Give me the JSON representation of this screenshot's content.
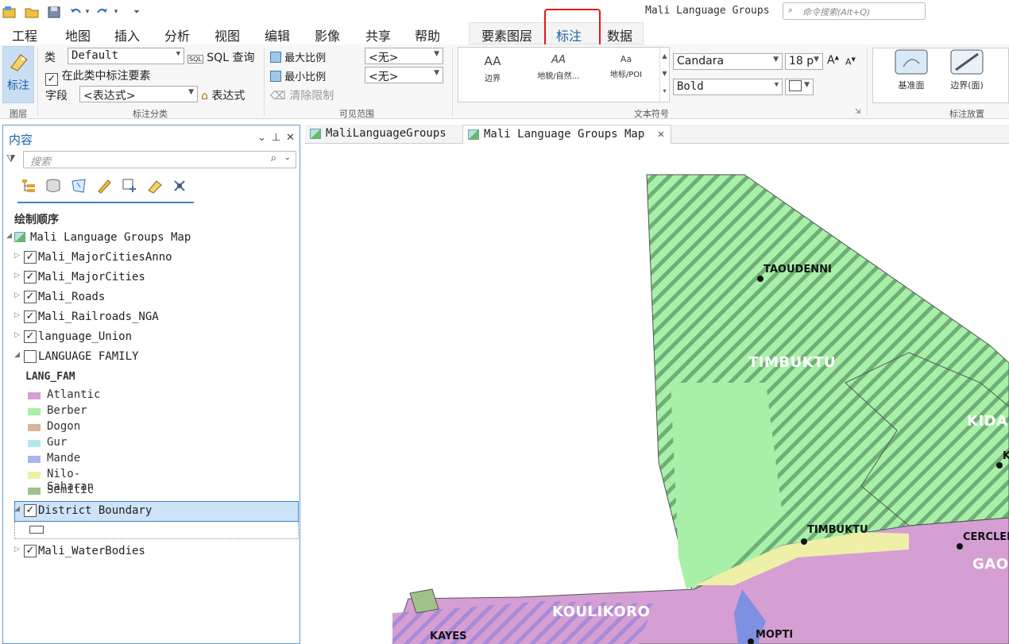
{
  "app": {
    "title": "Mali Language Groups",
    "command_search_placeholder": "命令搜索(Alt+Q)"
  },
  "ribbon": {
    "tabs": [
      "工程",
      "地图",
      "插入",
      "分析",
      "视图",
      "编辑",
      "影像",
      "共享",
      "帮助"
    ],
    "context_tabs": [
      "要素图层",
      "标注",
      "数据"
    ],
    "active_tab": "标注",
    "label_button": "标注",
    "layer_group_label": "图层",
    "class_label": "类",
    "class_value": "Default",
    "sql_query": "SQL 查询",
    "label_features_in_class": "在此类中标注要素",
    "field_label": "字段",
    "field_value": "<表达式>",
    "expression_button": "表达式",
    "label_class_group": "标注分类",
    "max_scale": "最大比例",
    "min_scale": "最小比例",
    "max_scale_value": "<无>",
    "min_scale_value": "<无>",
    "clear_limits": "清除限制",
    "visible_range_group": "可见范围",
    "styles": [
      {
        "sample": "AA",
        "label": "边界"
      },
      {
        "sample": "AA",
        "label": "地貌/自然…"
      },
      {
        "sample": "Aa",
        "label": "地标/POI"
      }
    ],
    "font_name": "Candara",
    "font_size": "18 p",
    "font_style": "Bold",
    "text_symbol_group": "文本符号",
    "placements": [
      {
        "label": "基准面"
      },
      {
        "label": "边界(面)"
      }
    ],
    "label_placement_group": "标注放置"
  },
  "contents": {
    "title": "内容",
    "search_placeholder": "搜索",
    "drawing_order": "绘制顺序",
    "map_name": "Mali Language Groups Map",
    "layers": [
      {
        "name": "Mali_MajorCitiesAnno",
        "checked": "✓"
      },
      {
        "name": "Mali_MajorCities",
        "checked": "✓"
      },
      {
        "name": "Mali_Roads",
        "checked": "✓"
      },
      {
        "name": "Mali_Railroads_NGA",
        "checked": "✓"
      },
      {
        "name": "language_Union",
        "checked": "✓"
      },
      {
        "name": "LANGUAGE FAMILY",
        "checked": ""
      }
    ],
    "legend_field": "LANG_FAM",
    "legend": [
      {
        "name": "Atlantic",
        "color": "#d59fd3"
      },
      {
        "name": "Berber",
        "color": "#a8f0a8"
      },
      {
        "name": "Dogon",
        "color": "#d7b49a"
      },
      {
        "name": "Gur",
        "color": "#b4e8f0"
      },
      {
        "name": "Mande",
        "color": "#aab4f2"
      },
      {
        "name": "Nilo-Saharan",
        "color": "#eef0a8"
      },
      {
        "name": "Semitic",
        "color": "#9fc28a"
      }
    ],
    "district_boundary": "District Boundary",
    "water_bodies": "Mali_WaterBodies"
  },
  "doc_tabs": [
    "MaliLanguageGroups",
    "Mali Language Groups Map"
  ],
  "map": {
    "cities": [
      "TAOUDENNI",
      "TIMBUKTU",
      "CERCLED",
      "MOPTI",
      "KAYES",
      "K"
    ],
    "regions": [
      "TIMBUKTU",
      "KIDAL",
      "GAO",
      "KOULIKORO"
    ]
  }
}
